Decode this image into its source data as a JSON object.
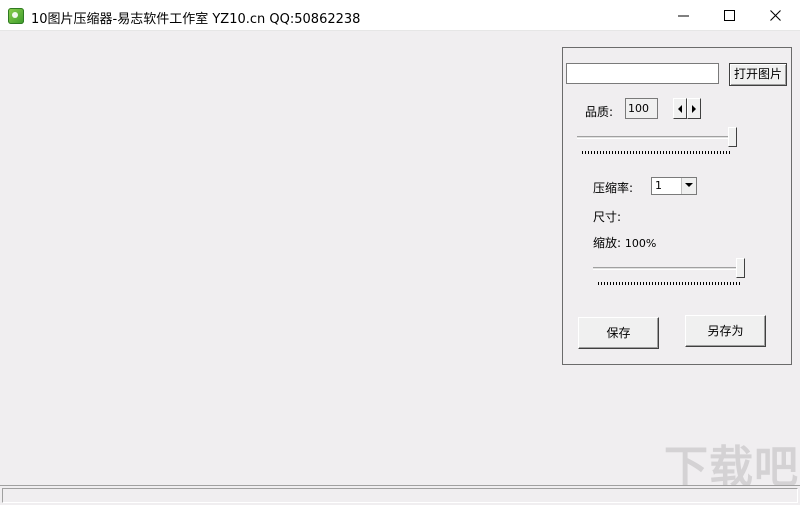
{
  "window": {
    "title": "10图片压缩器-易志软件工作室 YZ10.cn   QQ:50862238",
    "icon": "app-leaf-icon",
    "controls": [
      "minimize-icon",
      "maximize-icon",
      "close-icon"
    ]
  },
  "panel": {
    "file_path_value": "",
    "open_button_label": "打开图片",
    "quality_label": "品质:",
    "quality_value": "100",
    "quality_slider_level_percent": 100,
    "compression_label": "压缩率:",
    "compression_selected": "1",
    "size_label": "尺寸:",
    "scale_label": "缩放:",
    "scale_value": "100%",
    "scale_slider_level_percent": 100,
    "save_button_label": "保存",
    "save_as_button_label": "另存为"
  },
  "watermark": {
    "text": "下载吧"
  },
  "colors": {
    "window_background": "#f0eef0",
    "titlebar": "#ffffff",
    "border": "#6b6b6b"
  }
}
